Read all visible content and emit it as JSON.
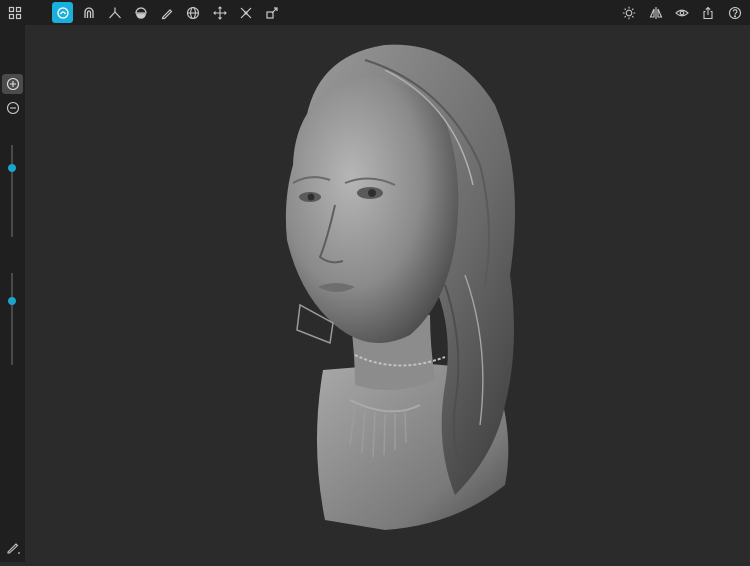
{
  "app": {
    "accent_color": "#19b1dc",
    "background_color": "#2a2a2a",
    "toolbar_color": "#1f1f1f"
  },
  "toolbar": {
    "left_tools": [
      {
        "icon": "grid-menu-icon",
        "active": false
      },
      {
        "icon": "sculpt-brush-icon",
        "active": true
      },
      {
        "icon": "magnet-icon",
        "active": false
      },
      {
        "icon": "crease-icon",
        "active": false
      },
      {
        "icon": "flatten-icon",
        "active": false
      },
      {
        "icon": "pencil-icon",
        "active": false
      },
      {
        "icon": "globe-icon",
        "active": false
      },
      {
        "icon": "move-icon",
        "active": false
      },
      {
        "icon": "symmetry-icon",
        "active": false
      },
      {
        "icon": "transform-icon",
        "active": false
      }
    ],
    "right_tools": [
      {
        "icon": "sun-icon"
      },
      {
        "icon": "mirror-icon"
      },
      {
        "icon": "eye-icon"
      },
      {
        "icon": "share-icon"
      },
      {
        "icon": "help-icon"
      }
    ]
  },
  "sidebar": {
    "zoom_in_icon": "plus-circle-icon",
    "zoom_out_icon": "minus-circle-icon",
    "radius_slider_value": 0.75,
    "intensity_slider_value": 0.7,
    "pen_icon": "pen-icon"
  },
  "viewport": {
    "model": "sculpted-female-bust"
  }
}
